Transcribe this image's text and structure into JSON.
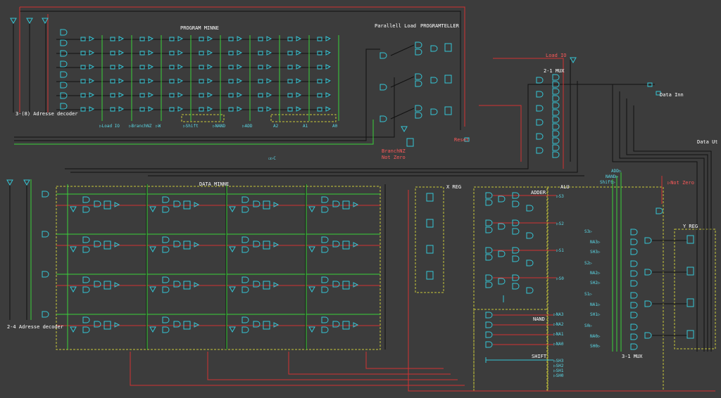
{
  "colors": {
    "background": "#3c3c3c",
    "wire_black": "#111111",
    "wire_red": "#d23232",
    "wire_green": "#3ad23a",
    "component": "#35c6d6",
    "module_border": "#c9c93a",
    "text": "#ffffff",
    "text_red": "#ff5a5a"
  },
  "titles": {
    "program_memory": "PROGRAM MINNE",
    "data_memory": "DATA MINNE",
    "parallel_load": "Parallell Load",
    "program_counter": "PROGRAMTELLER",
    "mux21": "2-1 MUX",
    "x_reg": "X REG",
    "alu": "ALU",
    "adder": "ADDER",
    "nand": "NAND",
    "shift": "SHIFT",
    "mux31": "3-1 MUX",
    "y_reg": "Y REG",
    "decoder38": "3-(8) Adresse decoder",
    "decoder24": "2-4 Adresse decoder",
    "data_in": "Data Inn",
    "data_out": "Data Ut"
  },
  "program_outputs": [
    "Load IO",
    "BranchNZ",
    "W",
    "Shift",
    "NAND",
    "ADD",
    "A2",
    "A1",
    "A0"
  ],
  "pc_signals": {
    "branch": "BranchNZ",
    "not_zero": "Not Zero",
    "reset": "Reset",
    "load_io": "Load IO"
  },
  "misc_pin": "C",
  "adder_outputs": [
    "S3",
    "S2",
    "S1",
    "S0"
  ],
  "nand_outputs": [
    "NA3",
    "NA2",
    "NA1",
    "NA0"
  ],
  "shift_outputs": [
    "SH3",
    "SH2",
    "SH1",
    "SH0"
  ],
  "mux31_inputs": [
    "S3",
    "NA3",
    "SH3",
    "S2",
    "NA2",
    "SH2",
    "S1",
    "NA1",
    "SH1",
    "S0",
    "NA0",
    "SH0"
  ],
  "alu_control": [
    "ADD",
    "NAND",
    "Shift"
  ],
  "not_zero_flag": "Not Zero"
}
